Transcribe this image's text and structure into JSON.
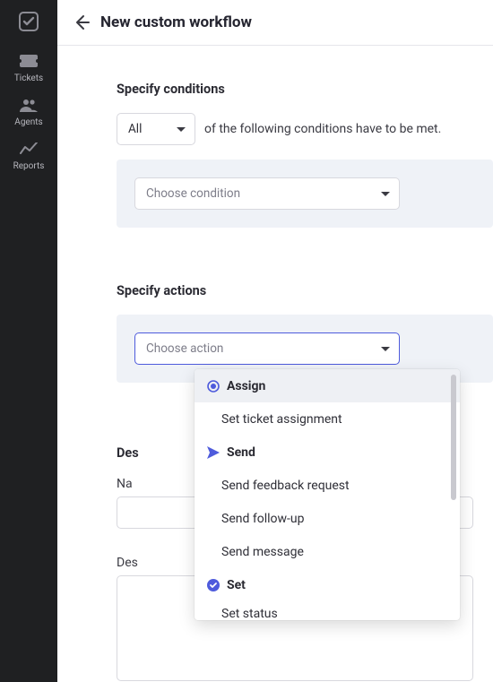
{
  "sidebar": {
    "items": [
      {
        "label": "Tickets"
      },
      {
        "label": "Agents"
      },
      {
        "label": "Reports"
      }
    ]
  },
  "header": {
    "title": "New custom workflow"
  },
  "conditions": {
    "section_title": "Specify conditions",
    "match_mode_value": "All",
    "match_text": "of the following conditions have to be met.",
    "choose_placeholder": "Choose condition"
  },
  "actions": {
    "section_title": "Specify actions",
    "choose_placeholder": "Choose action",
    "dropdown": {
      "groups": [
        {
          "label": "Assign",
          "icon": "radio",
          "options": [
            "Set ticket assignment"
          ]
        },
        {
          "label": "Send",
          "icon": "send",
          "options": [
            "Send feedback request",
            "Send follow-up",
            "Send message"
          ]
        },
        {
          "label": "Set",
          "icon": "check-circle",
          "options": [
            "Set status"
          ]
        }
      ]
    }
  },
  "describe": {
    "section_label_prefix": "Des",
    "name_label": "Na",
    "description_label": "Des"
  },
  "colors": {
    "accent": "#4e5bdc",
    "sidebar_bg": "#1f2022",
    "panel_bg": "#eff2f7"
  }
}
